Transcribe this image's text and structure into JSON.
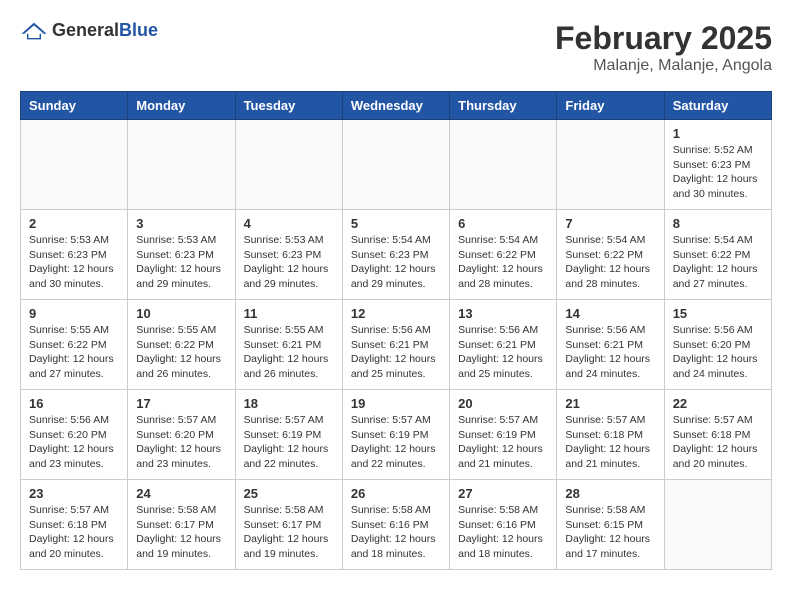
{
  "header": {
    "logo_general": "General",
    "logo_blue": "Blue",
    "title": "February 2025",
    "subtitle": "Malanje, Malanje, Angola"
  },
  "calendar": {
    "days_of_week": [
      "Sunday",
      "Monday",
      "Tuesday",
      "Wednesday",
      "Thursday",
      "Friday",
      "Saturday"
    ],
    "weeks": [
      [
        {
          "day": "",
          "info": ""
        },
        {
          "day": "",
          "info": ""
        },
        {
          "day": "",
          "info": ""
        },
        {
          "day": "",
          "info": ""
        },
        {
          "day": "",
          "info": ""
        },
        {
          "day": "",
          "info": ""
        },
        {
          "day": "1",
          "info": "Sunrise: 5:52 AM\nSunset: 6:23 PM\nDaylight: 12 hours and 30 minutes."
        }
      ],
      [
        {
          "day": "2",
          "info": "Sunrise: 5:53 AM\nSunset: 6:23 PM\nDaylight: 12 hours and 30 minutes."
        },
        {
          "day": "3",
          "info": "Sunrise: 5:53 AM\nSunset: 6:23 PM\nDaylight: 12 hours and 29 minutes."
        },
        {
          "day": "4",
          "info": "Sunrise: 5:53 AM\nSunset: 6:23 PM\nDaylight: 12 hours and 29 minutes."
        },
        {
          "day": "5",
          "info": "Sunrise: 5:54 AM\nSunset: 6:23 PM\nDaylight: 12 hours and 29 minutes."
        },
        {
          "day": "6",
          "info": "Sunrise: 5:54 AM\nSunset: 6:22 PM\nDaylight: 12 hours and 28 minutes."
        },
        {
          "day": "7",
          "info": "Sunrise: 5:54 AM\nSunset: 6:22 PM\nDaylight: 12 hours and 28 minutes."
        },
        {
          "day": "8",
          "info": "Sunrise: 5:54 AM\nSunset: 6:22 PM\nDaylight: 12 hours and 27 minutes."
        }
      ],
      [
        {
          "day": "9",
          "info": "Sunrise: 5:55 AM\nSunset: 6:22 PM\nDaylight: 12 hours and 27 minutes."
        },
        {
          "day": "10",
          "info": "Sunrise: 5:55 AM\nSunset: 6:22 PM\nDaylight: 12 hours and 26 minutes."
        },
        {
          "day": "11",
          "info": "Sunrise: 5:55 AM\nSunset: 6:21 PM\nDaylight: 12 hours and 26 minutes."
        },
        {
          "day": "12",
          "info": "Sunrise: 5:56 AM\nSunset: 6:21 PM\nDaylight: 12 hours and 25 minutes."
        },
        {
          "day": "13",
          "info": "Sunrise: 5:56 AM\nSunset: 6:21 PM\nDaylight: 12 hours and 25 minutes."
        },
        {
          "day": "14",
          "info": "Sunrise: 5:56 AM\nSunset: 6:21 PM\nDaylight: 12 hours and 24 minutes."
        },
        {
          "day": "15",
          "info": "Sunrise: 5:56 AM\nSunset: 6:20 PM\nDaylight: 12 hours and 24 minutes."
        }
      ],
      [
        {
          "day": "16",
          "info": "Sunrise: 5:56 AM\nSunset: 6:20 PM\nDaylight: 12 hours and 23 minutes."
        },
        {
          "day": "17",
          "info": "Sunrise: 5:57 AM\nSunset: 6:20 PM\nDaylight: 12 hours and 23 minutes."
        },
        {
          "day": "18",
          "info": "Sunrise: 5:57 AM\nSunset: 6:19 PM\nDaylight: 12 hours and 22 minutes."
        },
        {
          "day": "19",
          "info": "Sunrise: 5:57 AM\nSunset: 6:19 PM\nDaylight: 12 hours and 22 minutes."
        },
        {
          "day": "20",
          "info": "Sunrise: 5:57 AM\nSunset: 6:19 PM\nDaylight: 12 hours and 21 minutes."
        },
        {
          "day": "21",
          "info": "Sunrise: 5:57 AM\nSunset: 6:18 PM\nDaylight: 12 hours and 21 minutes."
        },
        {
          "day": "22",
          "info": "Sunrise: 5:57 AM\nSunset: 6:18 PM\nDaylight: 12 hours and 20 minutes."
        }
      ],
      [
        {
          "day": "23",
          "info": "Sunrise: 5:57 AM\nSunset: 6:18 PM\nDaylight: 12 hours and 20 minutes."
        },
        {
          "day": "24",
          "info": "Sunrise: 5:58 AM\nSunset: 6:17 PM\nDaylight: 12 hours and 19 minutes."
        },
        {
          "day": "25",
          "info": "Sunrise: 5:58 AM\nSunset: 6:17 PM\nDaylight: 12 hours and 19 minutes."
        },
        {
          "day": "26",
          "info": "Sunrise: 5:58 AM\nSunset: 6:16 PM\nDaylight: 12 hours and 18 minutes."
        },
        {
          "day": "27",
          "info": "Sunrise: 5:58 AM\nSunset: 6:16 PM\nDaylight: 12 hours and 18 minutes."
        },
        {
          "day": "28",
          "info": "Sunrise: 5:58 AM\nSunset: 6:15 PM\nDaylight: 12 hours and 17 minutes."
        },
        {
          "day": "",
          "info": ""
        }
      ]
    ]
  }
}
